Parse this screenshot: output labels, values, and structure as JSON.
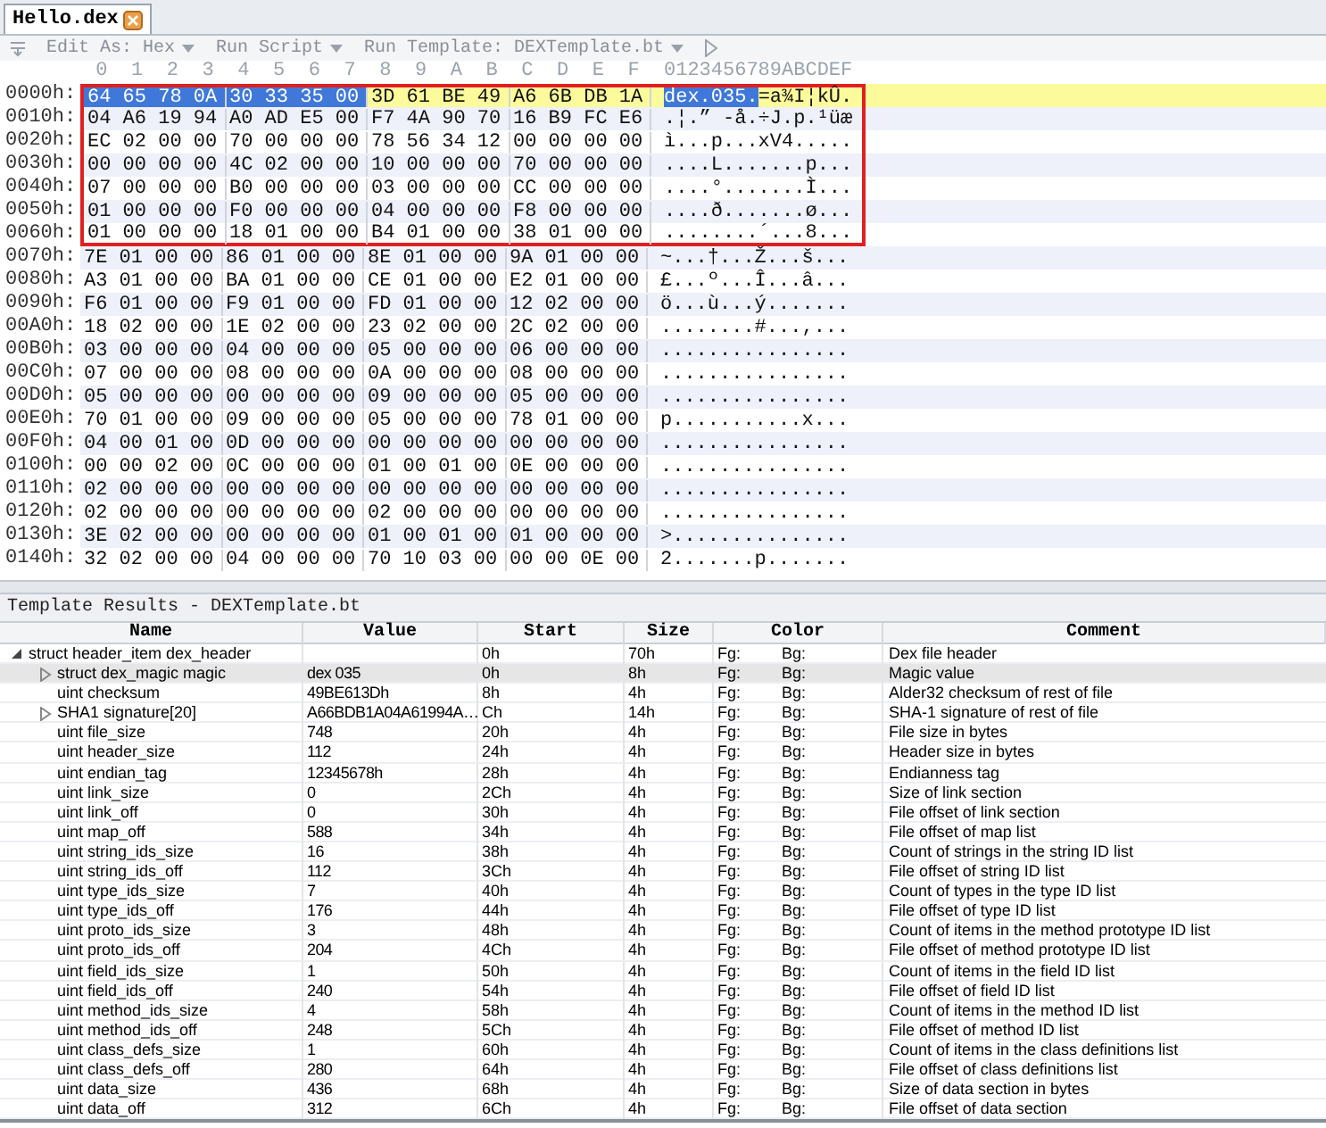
{
  "tab": {
    "label": "Hello.dex"
  },
  "toolbar": {
    "items": [
      {
        "label": "Edit As: Hex",
        "kind": "dropdown"
      },
      {
        "label": "Run Script",
        "kind": "dropdown"
      },
      {
        "label": "Run Template: DEXTemplate.bt",
        "kind": "dropdown"
      }
    ]
  },
  "hex_view": {
    "column_header": [
      "0",
      "1",
      "2",
      "3",
      "4",
      "5",
      "6",
      "7",
      "8",
      "9",
      "A",
      "B",
      "C",
      "D",
      "E",
      "F"
    ],
    "ascii_header": "0123456789ABCDEF",
    "rows": [
      {
        "address": "0000h:",
        "current": true,
        "framed": true,
        "groups": [
          {
            "hex": "64 65 78 0A",
            "selected": true
          },
          {
            "hex": "30 33 35 00",
            "selected": true
          },
          {
            "hex": "3D 61 BE 49",
            "selected": false
          },
          {
            "hex": "A6 6B DB 1A",
            "selected": false
          }
        ],
        "ascii": [
          {
            "text": "dex.035.",
            "selected": true
          },
          {
            "text": "=a¾I¦kÛ.",
            "selected": false
          }
        ]
      },
      {
        "address": "0010h:",
        "current": false,
        "framed": true,
        "groups": [
          {
            "hex": "04 A6 19 94",
            "selected": false
          },
          {
            "hex": "A0 AD E5 00",
            "selected": false
          },
          {
            "hex": "F7 4A 90 70",
            "selected": false
          },
          {
            "hex": "16 B9 FC E6",
            "selected": false
          }
        ],
        "ascii": [
          {
            "text": ".¦.” -å.÷J.p.¹üæ",
            "selected": false
          }
        ]
      },
      {
        "address": "0020h:",
        "current": false,
        "framed": true,
        "groups": [
          {
            "hex": "EC 02 00 00",
            "selected": false
          },
          {
            "hex": "70 00 00 00",
            "selected": false
          },
          {
            "hex": "78 56 34 12",
            "selected": false
          },
          {
            "hex": "00 00 00 00",
            "selected": false
          }
        ],
        "ascii": [
          {
            "text": "ì...p...xV4.....",
            "selected": false
          }
        ]
      },
      {
        "address": "0030h:",
        "current": false,
        "framed": true,
        "groups": [
          {
            "hex": "00 00 00 00",
            "selected": false
          },
          {
            "hex": "4C 02 00 00",
            "selected": false
          },
          {
            "hex": "10 00 00 00",
            "selected": false
          },
          {
            "hex": "70 00 00 00",
            "selected": false
          }
        ],
        "ascii": [
          {
            "text": "....L.......p...",
            "selected": false
          }
        ]
      },
      {
        "address": "0040h:",
        "current": false,
        "framed": true,
        "groups": [
          {
            "hex": "07 00 00 00",
            "selected": false
          },
          {
            "hex": "B0 00 00 00",
            "selected": false
          },
          {
            "hex": "03 00 00 00",
            "selected": false
          },
          {
            "hex": "CC 00 00 00",
            "selected": false
          }
        ],
        "ascii": [
          {
            "text": "....°.......Ì...",
            "selected": false
          }
        ]
      },
      {
        "address": "0050h:",
        "current": false,
        "framed": true,
        "groups": [
          {
            "hex": "01 00 00 00",
            "selected": false
          },
          {
            "hex": "F0 00 00 00",
            "selected": false
          },
          {
            "hex": "04 00 00 00",
            "selected": false
          },
          {
            "hex": "F8 00 00 00",
            "selected": false
          }
        ],
        "ascii": [
          {
            "text": "....ð.......ø...",
            "selected": false
          }
        ]
      },
      {
        "address": "0060h:",
        "current": false,
        "framed": true,
        "groups": [
          {
            "hex": "01 00 00 00",
            "selected": false
          },
          {
            "hex": "18 01 00 00",
            "selected": false
          },
          {
            "hex": "B4 01 00 00",
            "selected": false
          },
          {
            "hex": "38 01 00 00",
            "selected": false
          }
        ],
        "ascii": [
          {
            "text": "........´...8...",
            "selected": false
          }
        ]
      },
      {
        "address": "0070h:",
        "current": false,
        "framed": false,
        "groups": [
          {
            "hex": "7E 01 00 00",
            "selected": false
          },
          {
            "hex": "86 01 00 00",
            "selected": false
          },
          {
            "hex": "8E 01 00 00",
            "selected": false
          },
          {
            "hex": "9A 01 00 00",
            "selected": false
          }
        ],
        "ascii": [
          {
            "text": "~...†...Ž...š...",
            "selected": false
          }
        ]
      },
      {
        "address": "0080h:",
        "current": false,
        "framed": false,
        "groups": [
          {
            "hex": "A3 01 00 00",
            "selected": false
          },
          {
            "hex": "BA 01 00 00",
            "selected": false
          },
          {
            "hex": "CE 01 00 00",
            "selected": false
          },
          {
            "hex": "E2 01 00 00",
            "selected": false
          }
        ],
        "ascii": [
          {
            "text": "£...º...Î...â...",
            "selected": false
          }
        ]
      },
      {
        "address": "0090h:",
        "current": false,
        "framed": false,
        "groups": [
          {
            "hex": "F6 01 00 00",
            "selected": false
          },
          {
            "hex": "F9 01 00 00",
            "selected": false
          },
          {
            "hex": "FD 01 00 00",
            "selected": false
          },
          {
            "hex": "12 02 00 00",
            "selected": false
          }
        ],
        "ascii": [
          {
            "text": "ö...ù...ý.......",
            "selected": false
          }
        ]
      },
      {
        "address": "00A0h:",
        "current": false,
        "framed": false,
        "groups": [
          {
            "hex": "18 02 00 00",
            "selected": false
          },
          {
            "hex": "1E 02 00 00",
            "selected": false
          },
          {
            "hex": "23 02 00 00",
            "selected": false
          },
          {
            "hex": "2C 02 00 00",
            "selected": false
          }
        ],
        "ascii": [
          {
            "text": "........#...,...",
            "selected": false
          }
        ]
      },
      {
        "address": "00B0h:",
        "current": false,
        "framed": false,
        "groups": [
          {
            "hex": "03 00 00 00",
            "selected": false
          },
          {
            "hex": "04 00 00 00",
            "selected": false
          },
          {
            "hex": "05 00 00 00",
            "selected": false
          },
          {
            "hex": "06 00 00 00",
            "selected": false
          }
        ],
        "ascii": [
          {
            "text": "................",
            "selected": false
          }
        ]
      },
      {
        "address": "00C0h:",
        "current": false,
        "framed": false,
        "groups": [
          {
            "hex": "07 00 00 00",
            "selected": false
          },
          {
            "hex": "08 00 00 00",
            "selected": false
          },
          {
            "hex": "0A 00 00 00",
            "selected": false
          },
          {
            "hex": "08 00 00 00",
            "selected": false
          }
        ],
        "ascii": [
          {
            "text": "................",
            "selected": false
          }
        ]
      },
      {
        "address": "00D0h:",
        "current": false,
        "framed": false,
        "groups": [
          {
            "hex": "05 00 00 00",
            "selected": false
          },
          {
            "hex": "00 00 00 00",
            "selected": false
          },
          {
            "hex": "09 00 00 00",
            "selected": false
          },
          {
            "hex": "05 00 00 00",
            "selected": false
          }
        ],
        "ascii": [
          {
            "text": "................",
            "selected": false
          }
        ]
      },
      {
        "address": "00E0h:",
        "current": false,
        "framed": false,
        "groups": [
          {
            "hex": "70 01 00 00",
            "selected": false
          },
          {
            "hex": "09 00 00 00",
            "selected": false
          },
          {
            "hex": "05 00 00 00",
            "selected": false
          },
          {
            "hex": "78 01 00 00",
            "selected": false
          }
        ],
        "ascii": [
          {
            "text": "p...........x...",
            "selected": false
          }
        ]
      },
      {
        "address": "00F0h:",
        "current": false,
        "framed": false,
        "groups": [
          {
            "hex": "04 00 01 00",
            "selected": false
          },
          {
            "hex": "0D 00 00 00",
            "selected": false
          },
          {
            "hex": "00 00 00 00",
            "selected": false
          },
          {
            "hex": "00 00 00 00",
            "selected": false
          }
        ],
        "ascii": [
          {
            "text": "................",
            "selected": false
          }
        ]
      },
      {
        "address": "0100h:",
        "current": false,
        "framed": false,
        "groups": [
          {
            "hex": "00 00 02 00",
            "selected": false
          },
          {
            "hex": "0C 00 00 00",
            "selected": false
          },
          {
            "hex": "01 00 01 00",
            "selected": false
          },
          {
            "hex": "0E 00 00 00",
            "selected": false
          }
        ],
        "ascii": [
          {
            "text": "................",
            "selected": false
          }
        ]
      },
      {
        "address": "0110h:",
        "current": false,
        "framed": false,
        "groups": [
          {
            "hex": "02 00 00 00",
            "selected": false
          },
          {
            "hex": "00 00 00 00",
            "selected": false
          },
          {
            "hex": "00 00 00 00",
            "selected": false
          },
          {
            "hex": "00 00 00 00",
            "selected": false
          }
        ],
        "ascii": [
          {
            "text": "................",
            "selected": false
          }
        ]
      },
      {
        "address": "0120h:",
        "current": false,
        "framed": false,
        "groups": [
          {
            "hex": "02 00 00 00",
            "selected": false
          },
          {
            "hex": "00 00 00 00",
            "selected": false
          },
          {
            "hex": "02 00 00 00",
            "selected": false
          },
          {
            "hex": "00 00 00 00",
            "selected": false
          }
        ],
        "ascii": [
          {
            "text": "................",
            "selected": false
          }
        ]
      },
      {
        "address": "0130h:",
        "current": false,
        "framed": false,
        "groups": [
          {
            "hex": "3E 02 00 00",
            "selected": false
          },
          {
            "hex": "00 00 00 00",
            "selected": false
          },
          {
            "hex": "01 00 01 00",
            "selected": false
          },
          {
            "hex": "01 00 00 00",
            "selected": false
          }
        ],
        "ascii": [
          {
            "text": ">...............",
            "selected": false
          }
        ]
      },
      {
        "address": "0140h:",
        "current": false,
        "framed": false,
        "groups": [
          {
            "hex": "32 02 00 00",
            "selected": false
          },
          {
            "hex": "04 00 00 00",
            "selected": false
          },
          {
            "hex": "70 10 03 00",
            "selected": false
          },
          {
            "hex": "00 00 0E 00",
            "selected": false
          }
        ],
        "ascii": [
          {
            "text": "2.......p.......",
            "selected": false
          }
        ]
      }
    ]
  },
  "template_results": {
    "title": "Template Results - DEXTemplate.bt",
    "columns": [
      "Name",
      "Value",
      "Start",
      "Size",
      "Color",
      "Comment"
    ],
    "rows": [
      {
        "name": "struct header_item dex_header",
        "value": "",
        "start": "0h",
        "size": "70h",
        "fg": "Fg:",
        "bg": "Bg:",
        "comment": "Dex file header",
        "selected": false,
        "expanded": true,
        "children": [
          {
            "name": "struct dex_magic magic",
            "value": "dex 035",
            "start": "0h",
            "size": "8h",
            "fg": "Fg:",
            "bg": "Bg:",
            "comment": "Magic value",
            "selected": true,
            "expanded": false
          },
          {
            "name": "uint checksum",
            "value": "49BE613Dh",
            "start": "8h",
            "size": "4h",
            "fg": "Fg:",
            "bg": "Bg:",
            "comment": "Alder32 checksum of rest of file",
            "selected": false
          },
          {
            "name": "SHA1 signature[20]",
            "value": "A66BDB1A04A61994A…",
            "start": "Ch",
            "size": "14h",
            "fg": "Fg:",
            "bg": "Bg:",
            "comment": "SHA-1 signature of rest of file",
            "selected": false,
            "expanded": false
          },
          {
            "name": "uint file_size",
            "value": "748",
            "start": "20h",
            "size": "4h",
            "fg": "Fg:",
            "bg": "Bg:",
            "comment": "File size in bytes",
            "selected": false
          },
          {
            "name": "uint header_size",
            "value": "112",
            "start": "24h",
            "size": "4h",
            "fg": "Fg:",
            "bg": "Bg:",
            "comment": "Header size in bytes",
            "selected": false
          },
          {
            "name": "uint endian_tag",
            "value": "12345678h",
            "start": "28h",
            "size": "4h",
            "fg": "Fg:",
            "bg": "Bg:",
            "comment": "Endianness tag",
            "selected": false
          },
          {
            "name": "uint link_size",
            "value": "0",
            "start": "2Ch",
            "size": "4h",
            "fg": "Fg:",
            "bg": "Bg:",
            "comment": "Size of link section",
            "selected": false
          },
          {
            "name": "uint link_off",
            "value": "0",
            "start": "30h",
            "size": "4h",
            "fg": "Fg:",
            "bg": "Bg:",
            "comment": "File offset of link section",
            "selected": false
          },
          {
            "name": "uint map_off",
            "value": "588",
            "start": "34h",
            "size": "4h",
            "fg": "Fg:",
            "bg": "Bg:",
            "comment": "File offset of map list",
            "selected": false
          },
          {
            "name": "uint string_ids_size",
            "value": "16",
            "start": "38h",
            "size": "4h",
            "fg": "Fg:",
            "bg": "Bg:",
            "comment": "Count of strings in the string ID list",
            "selected": false
          },
          {
            "name": "uint string_ids_off",
            "value": "112",
            "start": "3Ch",
            "size": "4h",
            "fg": "Fg:",
            "bg": "Bg:",
            "comment": "File offset of string ID list",
            "selected": false
          },
          {
            "name": "uint type_ids_size",
            "value": "7",
            "start": "40h",
            "size": "4h",
            "fg": "Fg:",
            "bg": "Bg:",
            "comment": "Count of types in the type ID list",
            "selected": false
          },
          {
            "name": "uint type_ids_off",
            "value": "176",
            "start": "44h",
            "size": "4h",
            "fg": "Fg:",
            "bg": "Bg:",
            "comment": "File offset of type ID list",
            "selected": false
          },
          {
            "name": "uint proto_ids_size",
            "value": "3",
            "start": "48h",
            "size": "4h",
            "fg": "Fg:",
            "bg": "Bg:",
            "comment": "Count of items in the method prototype ID list",
            "selected": false
          },
          {
            "name": "uint proto_ids_off",
            "value": "204",
            "start": "4Ch",
            "size": "4h",
            "fg": "Fg:",
            "bg": "Bg:",
            "comment": "File offset of method prototype ID list",
            "selected": false
          },
          {
            "name": "uint field_ids_size",
            "value": "1",
            "start": "50h",
            "size": "4h",
            "fg": "Fg:",
            "bg": "Bg:",
            "comment": "Count of items in the field ID list",
            "selected": false
          },
          {
            "name": "uint field_ids_off",
            "value": "240",
            "start": "54h",
            "size": "4h",
            "fg": "Fg:",
            "bg": "Bg:",
            "comment": "File offset of field ID list",
            "selected": false
          },
          {
            "name": "uint method_ids_size",
            "value": "4",
            "start": "58h",
            "size": "4h",
            "fg": "Fg:",
            "bg": "Bg:",
            "comment": "Count of items in the method ID list",
            "selected": false
          },
          {
            "name": "uint method_ids_off",
            "value": "248",
            "start": "5Ch",
            "size": "4h",
            "fg": "Fg:",
            "bg": "Bg:",
            "comment": "File offset of method ID list",
            "selected": false
          },
          {
            "name": "uint class_defs_size",
            "value": "1",
            "start": "60h",
            "size": "4h",
            "fg": "Fg:",
            "bg": "Bg:",
            "comment": "Count of items in the class definitions list",
            "selected": false
          },
          {
            "name": "uint class_defs_off",
            "value": "280",
            "start": "64h",
            "size": "4h",
            "fg": "Fg:",
            "bg": "Bg:",
            "comment": "File offset of class definitions list",
            "selected": false
          },
          {
            "name": "uint data_size",
            "value": "436",
            "start": "68h",
            "size": "4h",
            "fg": "Fg:",
            "bg": "Bg:",
            "comment": "Size of data section in bytes",
            "selected": false
          },
          {
            "name": "uint data_off",
            "value": "312",
            "start": "6Ch",
            "size": "4h",
            "fg": "Fg:",
            "bg": "Bg:",
            "comment": "File offset of data section",
            "selected": false
          }
        ]
      }
    ]
  }
}
